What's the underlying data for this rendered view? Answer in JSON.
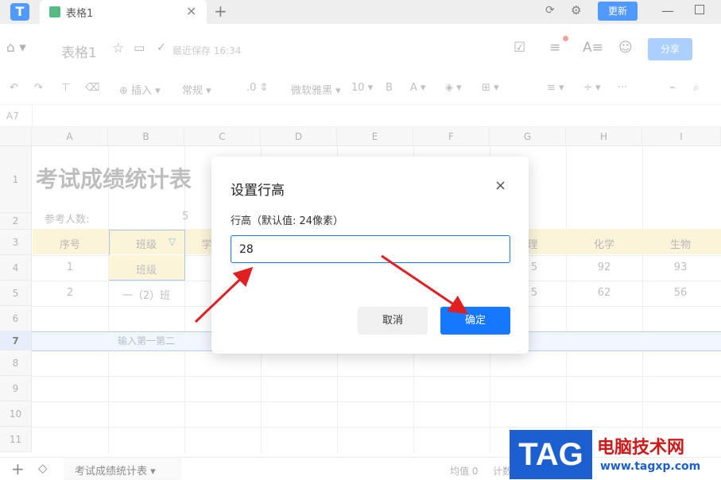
{
  "titlebar": {
    "logo": "T",
    "tab_label": "表格1",
    "tab_close": "×",
    "new_tab": "+",
    "update_label": "更新",
    "minimize": "—"
  },
  "toolbar1": {
    "doc_title": "表格1",
    "save_status": "最近保存 16:34",
    "share_label": "分享"
  },
  "toolbar2": {
    "insert_label": "⊕ 插入 ▾",
    "format_label": "常规 ▾",
    "decimal_label": ".0 ⇕",
    "font_label": "微软雅黑 ▾",
    "size_label": "10 ▾",
    "bold_label": "B",
    "font_color_label": "A ▾",
    "more_label": "···"
  },
  "formula_bar": {
    "cell_ref": "A7"
  },
  "grid": {
    "columns": [
      "A",
      "B",
      "C",
      "D",
      "E",
      "F",
      "G",
      "H",
      "I"
    ],
    "rows": [
      "1",
      "2",
      "3",
      "4",
      "5",
      "6",
      "7",
      "8",
      "9",
      "10",
      "11"
    ],
    "sheet_title": "考试成绩统计表",
    "participants_label": "参考人数:",
    "participants_value": "5",
    "headers": {
      "a": "序号",
      "b": "班级",
      "c": "学",
      "g": "理",
      "h": "化学",
      "i": "生物"
    },
    "row4": {
      "a": "1",
      "b": "班级",
      "g": "5",
      "h": "92",
      "i": "93"
    },
    "row5": {
      "a": "2",
      "b": "一（2）班",
      "g": "5",
      "h": "62",
      "i": "56"
    },
    "row7_hint": "输入第一第二"
  },
  "bottombar": {
    "add": "+",
    "sheet_tab": "考试成绩统计表 ▾",
    "avg_label": "均值 0",
    "count_label": "计数"
  },
  "dialog": {
    "title": "设置行高",
    "close": "×",
    "label": "行高（默认值: 24像素）",
    "value": "28",
    "cancel_label": "取消",
    "ok_label": "确定"
  },
  "watermark": {
    "tag": "TAG",
    "cn_text": "电脑技术网",
    "url": "www.tagxp.com"
  },
  "colors": {
    "accent": "#1677ff",
    "header_band": "#fbf0cc",
    "arrow": "#e02020"
  }
}
